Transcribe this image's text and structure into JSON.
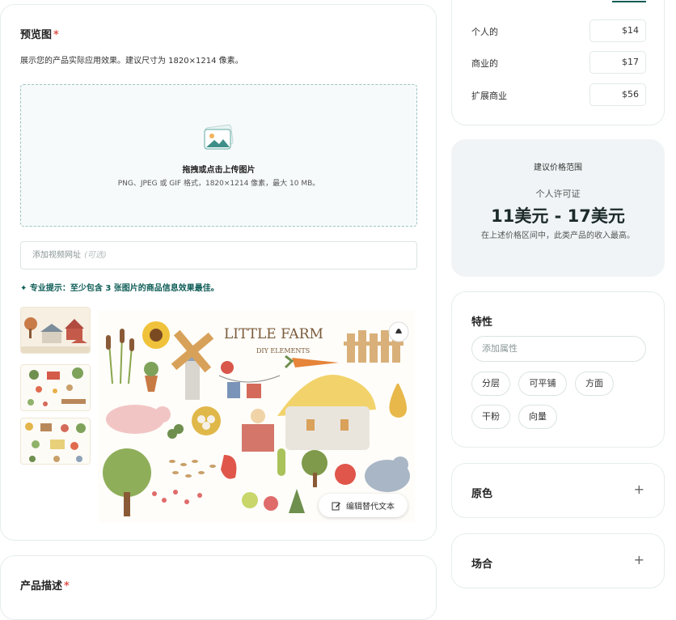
{
  "preview": {
    "title": "预览图",
    "required_mark": "*",
    "description": "展示您的产品实际应用效果。建议尺寸为 1820×1214 像素。",
    "upload_title": "拖拽或点击上传图片",
    "upload_hint": "PNG、JPEG 或 GIF 格式，1820×1214 像素，最大 10 MB。",
    "video_placeholder": "添加视频网址",
    "video_optional": "(可选)",
    "tip_prefix": "专业提示：",
    "tip_text": "至少包含 3 张图片的商品信息效果最佳。",
    "image_title": "LITTLE FARM",
    "image_subtitle": "DIY ELEMENTS",
    "alt_text_button": "编辑替代文本"
  },
  "description_card": {
    "title": "产品描述",
    "required_mark": "*"
  },
  "pricing": {
    "rows": [
      {
        "label": "个人的",
        "value": "$14"
      },
      {
        "label": "商业的",
        "value": "$17"
      },
      {
        "label": "扩展商业",
        "value": "$56"
      }
    ]
  },
  "suggestion": {
    "title": "建议价格范围",
    "license": "个人许可证",
    "range": "11美元 - 17美元",
    "note": "在上述价格区间中，此类产品的收入最高。"
  },
  "features": {
    "title": "特性",
    "add_placeholder": "添加属性",
    "tags": [
      "分层",
      "可平铺",
      "方面",
      "干粉",
      "向量"
    ]
  },
  "origin": {
    "title": "原色",
    "expand": "+"
  },
  "occasion": {
    "title": "场合",
    "expand": "+"
  },
  "colors": {
    "accent": "#0d5c56",
    "required": "#e0564b",
    "dashed": "#9cc4c0"
  }
}
